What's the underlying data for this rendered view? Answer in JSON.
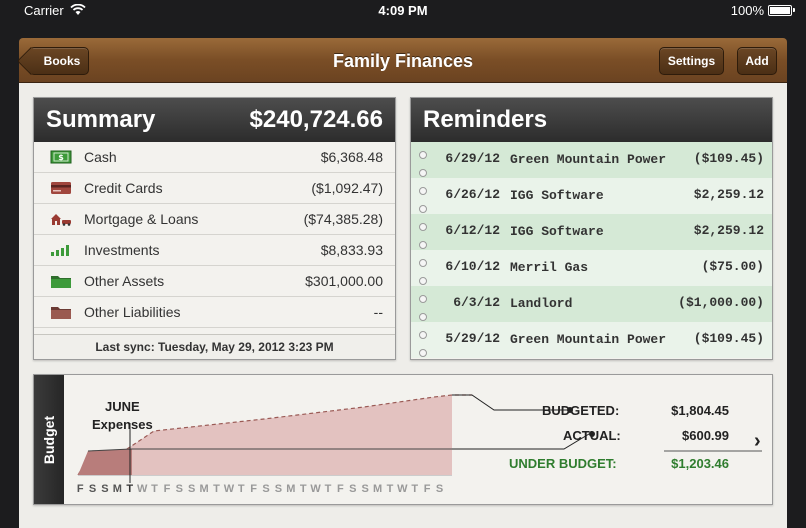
{
  "status_bar": {
    "carrier": "Carrier",
    "time": "4:09 PM",
    "battery": "100%"
  },
  "nav": {
    "title": "Family Finances",
    "back_label": "Books",
    "settings_label": "Settings",
    "add_label": "Add"
  },
  "summary": {
    "title": "Summary",
    "total": "$240,724.66",
    "rows": [
      {
        "label": "Cash",
        "value": "$6,368.48",
        "icon": "cash-icon"
      },
      {
        "label": "Credit Cards",
        "value": "($1,092.47)",
        "icon": "credit-card-icon"
      },
      {
        "label": "Mortgage & Loans",
        "value": "($74,385.28)",
        "icon": "house-car-icon"
      },
      {
        "label": "Investments",
        "value": "$8,833.93",
        "icon": "bar-chart-icon"
      },
      {
        "label": "Other Assets",
        "value": "$301,000.00",
        "icon": "green-folder-icon"
      },
      {
        "label": "Other Liabilities",
        "value": "--",
        "icon": "brown-folder-icon"
      }
    ],
    "last_sync": "Last sync: Tuesday, May 29, 2012 3:23 PM"
  },
  "reminders": {
    "title": "Reminders",
    "items": [
      {
        "date": "6/29/12",
        "name": "Green Mountain Power",
        "amount": "($109.45)"
      },
      {
        "date": "6/26/12",
        "name": "IGG Software",
        "amount": "$2,259.12"
      },
      {
        "date": "6/12/12",
        "name": "IGG Software",
        "amount": "$2,259.12"
      },
      {
        "date": "6/10/12",
        "name": "Merril Gas",
        "amount": "($75.00)"
      },
      {
        "date": "6/3/12",
        "name": "Landlord",
        "amount": "($1,000.00)"
      },
      {
        "date": "5/29/12",
        "name": "Green Mountain Power",
        "amount": "($109.45)"
      }
    ]
  },
  "budget": {
    "tab_label": "Budget",
    "month": "JUNE",
    "subtitle": "Expenses",
    "budgeted_label": "BUDGETED:",
    "budgeted_value": "$1,804.45",
    "actual_label": "ACTUAL:",
    "actual_value": "$600.99",
    "under_label": "UNDER BUDGET:",
    "under_value": "$1,203.46",
    "day_letters": [
      "F",
      "S",
      "S",
      "M",
      "T",
      "W",
      "T",
      "F",
      "S",
      "S",
      "M",
      "T",
      "W",
      "T",
      "F",
      "S",
      "S",
      "M",
      "T",
      "W",
      "T",
      "F",
      "S",
      "S",
      "M",
      "T",
      "W",
      "T",
      "F",
      "S"
    ],
    "today_index": 4,
    "colors": {
      "under": "#2f7d2e",
      "budget_fill": "#e3c2c0",
      "actual_fill": "#b87d7b"
    }
  }
}
